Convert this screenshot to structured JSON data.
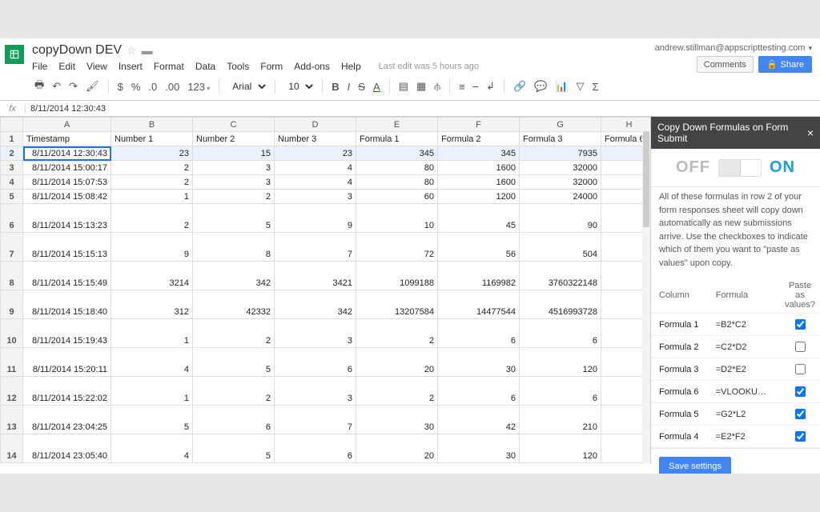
{
  "header": {
    "title": "copyDown DEV",
    "last_edit": "Last edit was 5 hours ago",
    "account": "andrew.stillman@appscripttesting.com",
    "comments_label": "Comments",
    "share_label": "Share"
  },
  "menus": [
    "File",
    "Edit",
    "View",
    "Insert",
    "Format",
    "Data",
    "Tools",
    "Form",
    "Add-ons",
    "Help"
  ],
  "toolbar": {
    "font": "Arial",
    "size": "10"
  },
  "formula_bar": "8/11/2014 12:30:43",
  "grid": {
    "col_letters": [
      "A",
      "B",
      "C",
      "D",
      "E",
      "F",
      "G",
      "H"
    ],
    "headers": [
      "Timestamp",
      "Number 1",
      "Number 2",
      "Number 3",
      "Formula 1",
      "Formula 2",
      "Formula 3",
      "Formula 6"
    ],
    "rows": [
      {
        "n": 2,
        "sel": true,
        "tall": false,
        "cells": [
          "8/11/2014 12:30:43",
          "23",
          "15",
          "23",
          "345",
          "345",
          "7935",
          ""
        ]
      },
      {
        "n": 3,
        "cells": [
          "8/11/2014 15:00:17",
          "2",
          "3",
          "4",
          "80",
          "1600",
          "32000",
          ""
        ]
      },
      {
        "n": 4,
        "cells": [
          "8/11/2014 15:07:53",
          "2",
          "3",
          "4",
          "80",
          "1600",
          "32000",
          ""
        ]
      },
      {
        "n": 5,
        "cells": [
          "8/11/2014 15:08:42",
          "1",
          "2",
          "3",
          "60",
          "1200",
          "24000",
          ""
        ]
      },
      {
        "n": 6,
        "tall": true,
        "cells": [
          "8/11/2014 15:13:23",
          "2",
          "5",
          "9",
          "10",
          "45",
          "90",
          ""
        ]
      },
      {
        "n": 7,
        "tall": true,
        "cells": [
          "8/11/2014 15:15:13",
          "9",
          "8",
          "7",
          "72",
          "56",
          "504",
          ""
        ]
      },
      {
        "n": 8,
        "tall": true,
        "cells": [
          "8/11/2014 15:15:49",
          "3214",
          "342",
          "3421",
          "1099188",
          "1169982",
          "3760322148",
          ""
        ]
      },
      {
        "n": 9,
        "tall": true,
        "cells": [
          "8/11/2014 15:18:40",
          "312",
          "42332",
          "342",
          "13207584",
          "14477544",
          "4516993728",
          ""
        ]
      },
      {
        "n": 10,
        "tall": true,
        "cells": [
          "8/11/2014 15:19:43",
          "1",
          "2",
          "3",
          "2",
          "6",
          "6",
          ""
        ]
      },
      {
        "n": 11,
        "tall": true,
        "cells": [
          "8/11/2014 15:20:11",
          "4",
          "5",
          "6",
          "20",
          "30",
          "120",
          ""
        ]
      },
      {
        "n": 12,
        "tall": true,
        "cells": [
          "8/11/2014 15:22:02",
          "1",
          "2",
          "3",
          "2",
          "6",
          "6",
          ""
        ]
      },
      {
        "n": 13,
        "tall": true,
        "cells": [
          "8/11/2014 23:04:25",
          "5",
          "6",
          "7",
          "30",
          "42",
          "210",
          ""
        ]
      },
      {
        "n": 14,
        "tall": true,
        "cells": [
          "8/11/2014 23:05:40",
          "4",
          "5",
          "6",
          "20",
          "30",
          "120",
          ""
        ]
      }
    ]
  },
  "sidebar": {
    "title": "Copy Down Formulas on Form Submit",
    "off": "OFF",
    "on": "ON",
    "description": "All of these formulas in row 2 of your form responses sheet will copy down automatically as new submissions arrive. Use the checkboxes to indicate which of them you want to \"paste as values\" upon copy.",
    "table_headers": [
      "Column",
      "Formula",
      "Paste as values?"
    ],
    "formula_rows": [
      {
        "col": "Formula 1",
        "formula": "=B2*C2",
        "checked": true
      },
      {
        "col": "Formula 2",
        "formula": "=C2*D2",
        "checked": false
      },
      {
        "col": "Formula 3",
        "formula": "=D2*E2",
        "checked": false
      },
      {
        "col": "Formula 6",
        "formula": "=VLOOKUP(A...",
        "checked": true
      },
      {
        "col": "Formula 5",
        "formula": "=G2*L2",
        "checked": true
      },
      {
        "col": "Formula 4",
        "formula": "=E2*F2",
        "checked": true
      }
    ],
    "save_label": "Save settings"
  }
}
